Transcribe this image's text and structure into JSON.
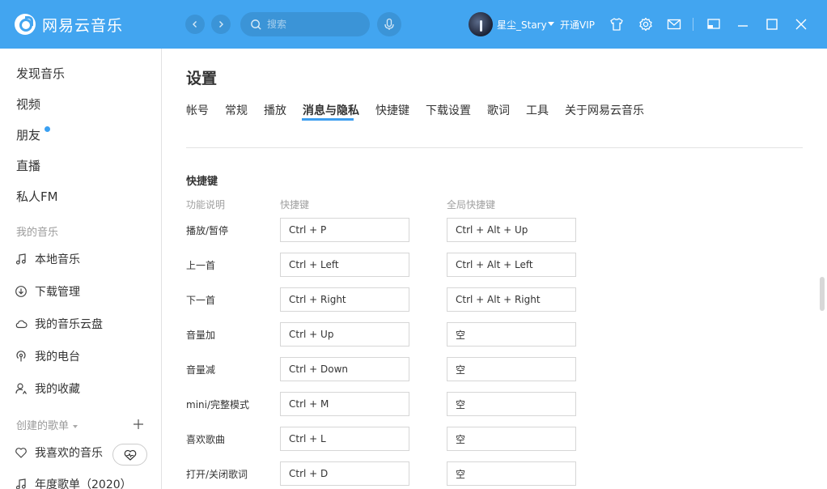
{
  "app": {
    "logo_text": "网易云音乐"
  },
  "topbar": {
    "search_placeholder": "搜索",
    "username": "星尘_Stary",
    "vip_label": "开通VIP"
  },
  "sidebar": {
    "main_items": [
      "发现音乐",
      "视频",
      "朋友",
      "直播",
      "私人FM"
    ],
    "my_music_title": "我的音乐",
    "my_music_items": [
      "本地音乐",
      "下载管理",
      "我的音乐云盘",
      "我的电台",
      "我的收藏"
    ],
    "created_playlists_title": "创建的歌单",
    "liked_music": "我喜欢的音乐",
    "partial_item": "年度歌单（2020）"
  },
  "settings": {
    "title": "设置",
    "tabs": [
      "帐号",
      "常规",
      "播放",
      "消息与隐私",
      "快捷键",
      "下载设置",
      "歌词",
      "工具",
      "关于网易云音乐"
    ],
    "active_tab": "消息与隐私",
    "shortcut_section_title": "快捷键",
    "columns": {
      "function": "功能说明",
      "shortcut": "快捷键",
      "global_shortcut": "全局快捷键"
    },
    "rows": [
      {
        "label": "播放/暂停",
        "shortcut": "Ctrl + P",
        "global": "Ctrl + Alt + Up"
      },
      {
        "label": "上一首",
        "shortcut": "Ctrl + Left",
        "global": "Ctrl + Alt + Left"
      },
      {
        "label": "下一首",
        "shortcut": "Ctrl + Right",
        "global": "Ctrl + Alt + Right"
      },
      {
        "label": "音量加",
        "shortcut": "Ctrl + Up",
        "global": "空"
      },
      {
        "label": "音量减",
        "shortcut": "Ctrl + Down",
        "global": "空"
      },
      {
        "label": "mini/完整模式",
        "shortcut": "Ctrl + M",
        "global": "空"
      },
      {
        "label": "喜欢歌曲",
        "shortcut": "Ctrl + L",
        "global": "空"
      },
      {
        "label": "打开/关闭歌词",
        "shortcut": "Ctrl + D",
        "global": "空"
      }
    ]
  },
  "colors": {
    "topbar": "#42a5f0",
    "accent": "#3c9ef0",
    "notify_dot": "#3aa0f2"
  },
  "icons": [
    "logo-icon",
    "back-icon",
    "forward-icon",
    "search-icon",
    "mic-icon",
    "skin-icon",
    "gear-icon",
    "mail-icon",
    "mini-mode-icon",
    "minimize-icon",
    "maximize-icon",
    "close-icon",
    "music-note-icon",
    "download-icon",
    "cloud-icon",
    "radio-icon",
    "collection-icon",
    "plus-icon",
    "heart-icon",
    "heart-mode-icon"
  ]
}
